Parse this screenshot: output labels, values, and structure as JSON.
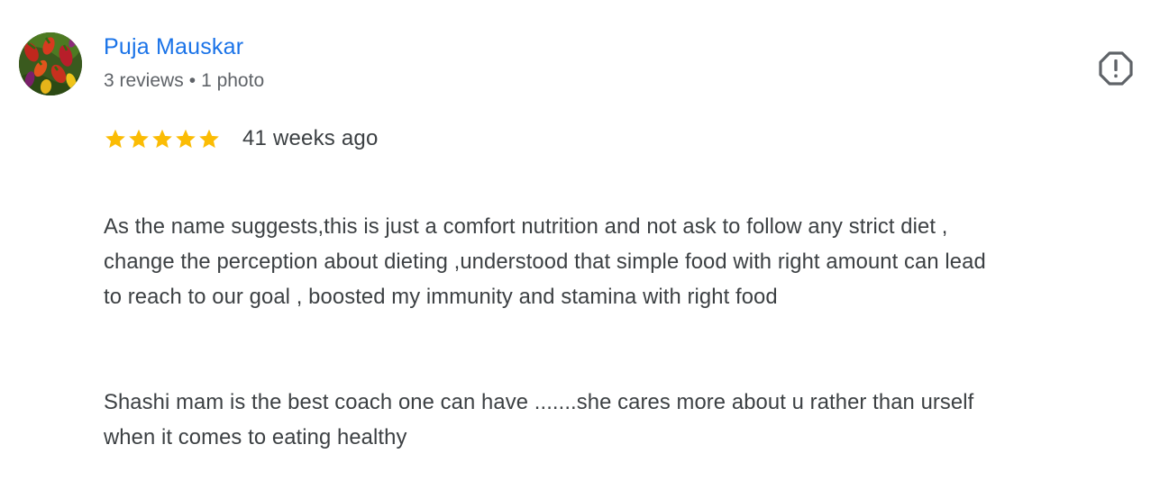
{
  "reviewer": {
    "name": "Puja Mauskar",
    "reviews_count": "3 reviews",
    "separator": "•",
    "photos_count": "1 photo"
  },
  "review": {
    "rating": 5,
    "max_rating": 5,
    "date": "41 weeks ago",
    "paragraphs": [
      "As the name suggests,this is just a comfort nutrition and not ask to follow any strict diet ,\nchange the perception about dieting ,understood that simple food with right amount can lead\nto reach to our goal , boosted my immunity and stamina with right food",
      "Shashi mam is the best coach one can have .......she cares more about u rather than urself\nwhen it comes to eating healthy"
    ]
  },
  "colors": {
    "name_link": "#1a73e8",
    "meta_text": "#5f6368",
    "body_text": "#3c4043",
    "star": "#fbbc04",
    "report_icon": "#5f6368"
  },
  "icons": {
    "report": "report-flag-icon",
    "star": "star-icon"
  }
}
